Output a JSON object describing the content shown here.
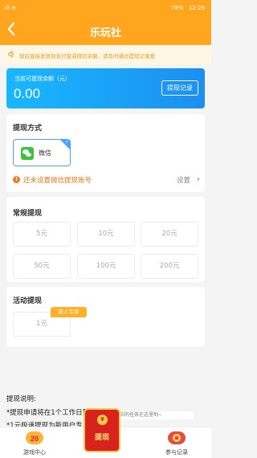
{
  "status_bar": {
    "signal_text": "ıll",
    "wifi_text": "≋",
    "battery_percent": "78%",
    "time": "12:29"
  },
  "header": {
    "title": "乐玩社",
    "back_icon": "chevron-left-icon"
  },
  "notice": {
    "text": "现后直接发放到支付宝或微信余额，请及时通过提现记录查"
  },
  "balance": {
    "label": "当前可提现余额（元）",
    "amount": "0.00",
    "record_button": "提现记录"
  },
  "withdraw_method": {
    "heading": "提现方式",
    "option_label": "微信",
    "warning_text": "还未设置微信提现账号",
    "setup_link": "设置"
  },
  "regular": {
    "heading": "常规提现",
    "amounts": [
      "5元",
      "10元",
      "20元",
      "50元",
      "100元",
      "200元"
    ]
  },
  "activity": {
    "heading": "活动提现",
    "badge": "新人专享",
    "amount": "1元"
  },
  "explanation": {
    "title": "提现说明:",
    "line1": "*提现申请将在1个工作日到账，",
    "line2": "*1元极速提现为新用户专",
    "tooltip": "进行中的任务在这里哟~"
  },
  "tabbar": {
    "items": [
      {
        "label": "游戏中心",
        "icon": "game-center-icon"
      },
      {
        "label": "参与记录",
        "icon": "records-icon"
      }
    ],
    "center_label": "提现",
    "center_coin": "¥"
  },
  "colors": {
    "accent": "#ffa51e",
    "balance_card": "#1c8ff0",
    "wechat_green": "#3cc33c",
    "warning": "#e07a1c"
  }
}
